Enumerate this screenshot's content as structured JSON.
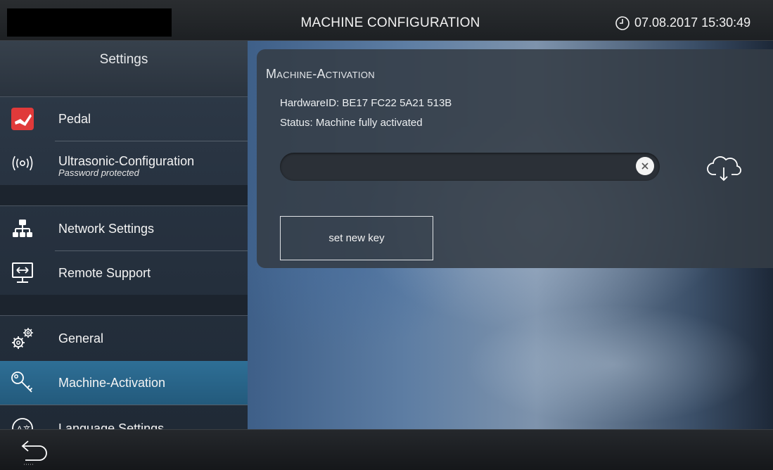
{
  "topbar": {
    "title": "MACHINE CONFIGURATION",
    "datetime": "07.08.2017 15:30:49",
    "clock_icon": "clock-icon"
  },
  "sidebar": {
    "header": "Settings",
    "items": [
      {
        "label": "Pedal",
        "icon": "pedal-icon",
        "sublabel": ""
      },
      {
        "label": "Ultrasonic-Configuration",
        "icon": "ultrasonic-icon",
        "sublabel": "Password protected"
      },
      {
        "label": "Network Settings",
        "icon": "network-icon",
        "sublabel": ""
      },
      {
        "label": "Remote Support",
        "icon": "remote-support-icon",
        "sublabel": ""
      },
      {
        "label": "General",
        "icon": "gears-icon",
        "sublabel": ""
      },
      {
        "label": "Machine-Activation",
        "icon": "key-icon",
        "sublabel": "",
        "active": true
      },
      {
        "label": "Language Settings",
        "icon": "language-icon",
        "sublabel": ""
      }
    ]
  },
  "panel": {
    "title": "Machine-Activation",
    "hardware_id": "HardwareID: BE17 FC22 5A21 513B",
    "status": "Status: Machine fully activated",
    "key_value": "",
    "set_key_label": "set new key"
  },
  "colors": {
    "accent_active": "#2e6f96",
    "pedal_icon_bg": "#e03a3a"
  }
}
